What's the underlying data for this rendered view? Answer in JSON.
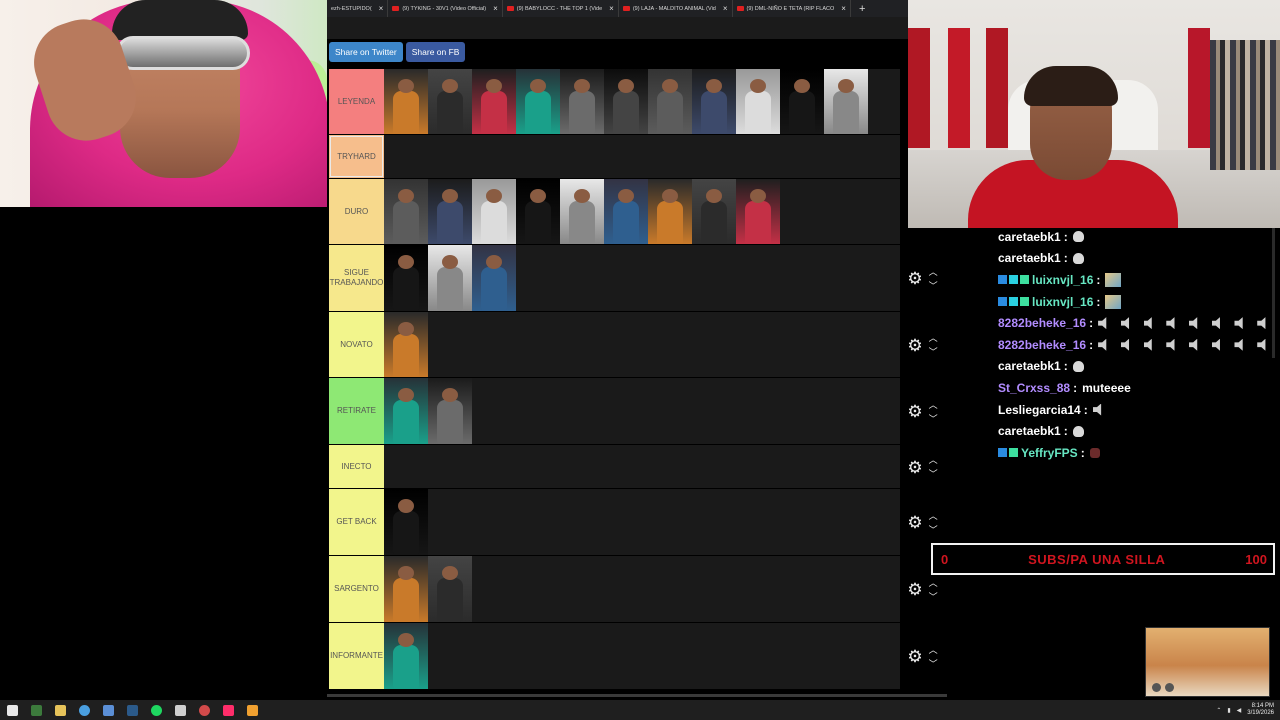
{
  "browser": {
    "tabs": [
      {
        "label": "ezh-ESTUPIDO(",
        "yt": false
      },
      {
        "label": "(9) TYKING - 30V1 (Video Official)",
        "yt": true
      },
      {
        "label": "(9) BABYLOCC - THE TOP 1 (Vide",
        "yt": true
      },
      {
        "label": "(9) LAJA - MALDITO ANIMAL (Vid",
        "yt": true
      },
      {
        "label": "(9) DML-NIÑO E TETA (RIP FLACO",
        "yt": true
      }
    ],
    "close_glyph": "×",
    "new_tab_glyph": "+"
  },
  "share": {
    "twitter_label": "Share on Twitter",
    "fb_label": "Share on FB",
    "twitter_color": "#3d86c9",
    "fb_color": "#3a5aa0"
  },
  "tiers": [
    {
      "label": "LEYENDA",
      "color": "#f47f7f",
      "count": 11,
      "controls": false
    },
    {
      "label": "TRYHARD",
      "color": "#f6be8c",
      "count": 0,
      "controls": false,
      "selected": true
    },
    {
      "label": "DURO",
      "color": "#f7d98c",
      "count": 9,
      "controls": false
    },
    {
      "label": "SIGUE TRABAJANDO",
      "color": "#f6e88c",
      "count": 3,
      "controls": true
    },
    {
      "label": "NOVATO",
      "color": "#f2f58c",
      "count": 1,
      "controls": true
    },
    {
      "label": "RETIRATE",
      "color": "#8ee874",
      "count": 2,
      "controls": true
    },
    {
      "label": "INECTO",
      "color": "#f2f58c",
      "count": 0,
      "controls": true
    },
    {
      "label": "GET BACK",
      "color": "#f2f58c",
      "count": 1,
      "controls": true
    },
    {
      "label": "SARGENTO",
      "color": "#f2f58c",
      "count": 2,
      "controls": true
    },
    {
      "label": "INFORMANTE",
      "color": "#f2f58c",
      "count": 1,
      "controls": true
    }
  ],
  "icons": {
    "gear": "gear-icon",
    "up": "chevron-up-icon",
    "down": "chevron-down-icon"
  },
  "chat": [
    {
      "user": "caretaebk1",
      "color": "#ffffff",
      "badges": [],
      "emotes": [
        "skull"
      ],
      "text": ""
    },
    {
      "user": "caretaebk1",
      "color": "#ffffff",
      "badges": [],
      "emotes": [
        "skull"
      ],
      "text": ""
    },
    {
      "user": "luixnvjl_16",
      "color": "#67e7c3",
      "badges": [
        "#2a8be0",
        "#2ad0e0",
        "#3ddf9f"
      ],
      "emotes": [
        "pic"
      ],
      "text": ""
    },
    {
      "user": "luixnvjl_16",
      "color": "#67e7c3",
      "badges": [
        "#2a8be0",
        "#2ad0e0",
        "#3ddf9f"
      ],
      "emotes": [
        "pic"
      ],
      "text": ""
    },
    {
      "user": "8282beheke_16",
      "color": "#b28cff",
      "badges": [],
      "emotes": [
        "speaker",
        "speaker",
        "speaker",
        "speaker",
        "speaker",
        "speaker",
        "speaker",
        "speaker"
      ],
      "text": ""
    },
    {
      "user": "8282beheke_16",
      "color": "#b28cff",
      "badges": [],
      "emotes": [
        "speaker",
        "speaker",
        "speaker",
        "speaker",
        "speaker",
        "speaker",
        "speaker",
        "speaker"
      ],
      "text": ""
    },
    {
      "user": "caretaebk1",
      "color": "#ffffff",
      "badges": [],
      "emotes": [
        "skull"
      ],
      "text": ""
    },
    {
      "user": "St_Crxss_88",
      "color": "#b28cff",
      "badges": [],
      "emotes": [],
      "text": "muteeee"
    },
    {
      "user": "Lesliegarcia14",
      "color": "#ffffff",
      "badges": [],
      "emotes": [
        "speaker"
      ],
      "text": ""
    },
    {
      "user": "caretaebk1",
      "color": "#ffffff",
      "badges": [],
      "emotes": [
        "skull"
      ],
      "text": ""
    },
    {
      "user": "YeffryFPS",
      "color": "#67e7c3",
      "badges": [
        "#2a8be0",
        "#3ddf9f"
      ],
      "emotes": [
        "red"
      ],
      "text": ""
    }
  ],
  "goal": {
    "start": "0",
    "title": "SUBS/PA UNA SILLA",
    "end": "100",
    "progress": 0
  },
  "taskbar": {
    "apps": [
      {
        "name": "windows-start-icon",
        "color": "#e8e8e8"
      },
      {
        "name": "terminal-icon",
        "color": "#3c7a3c"
      },
      {
        "name": "file-explorer-icon",
        "color": "#e6c35a"
      },
      {
        "name": "chrome-icon",
        "color": "#4a9fe0"
      },
      {
        "name": "window-icon",
        "color": "#5b8fd6"
      },
      {
        "name": "steam-icon",
        "color": "#2b5a8a"
      },
      {
        "name": "spotify-icon",
        "color": "#1ed760"
      },
      {
        "name": "pen-icon",
        "color": "#cfcfcf"
      },
      {
        "name": "obs-icon",
        "color": "#d24a4a"
      },
      {
        "name": "tiktok-icon",
        "color": "#ff2d6a"
      },
      {
        "name": "app-icon",
        "color": "#f0a030"
      }
    ],
    "time": "8:14 PM",
    "date": "3/19/2026"
  }
}
